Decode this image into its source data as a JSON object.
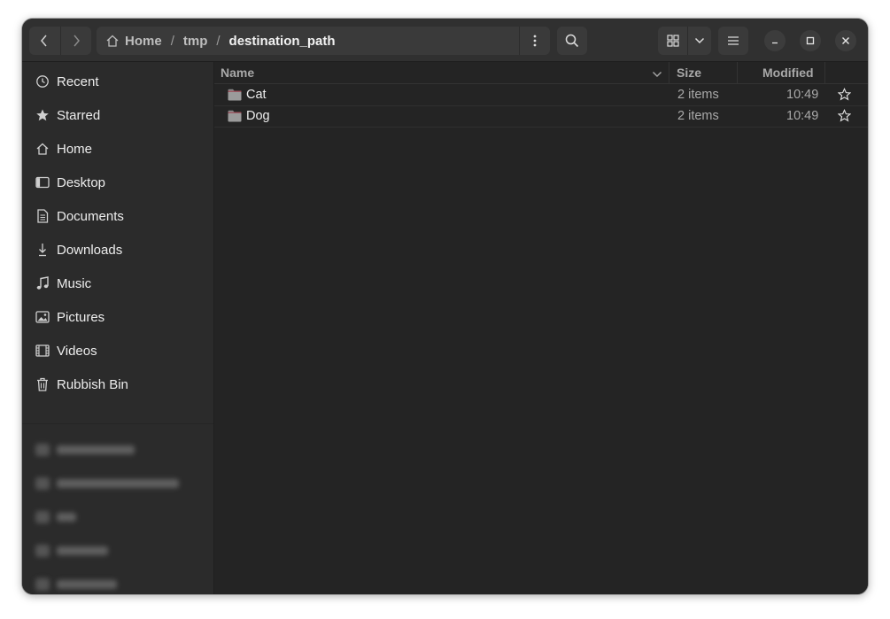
{
  "window": {
    "accent": "#e8e8e8"
  },
  "header": {
    "back_icon": "chevron-left-icon",
    "forward_icon": "chevron-right-icon",
    "breadcrumb": [
      {
        "label": "Home",
        "icon": "home-icon"
      },
      {
        "label": "tmp"
      },
      {
        "label": "destination_path"
      }
    ],
    "breadcrumb_separator": "/",
    "path_menu_icon": "kebab-menu-icon",
    "search_icon": "search-icon",
    "view_icon": "grid-view-icon",
    "view_options_icon": "chevron-down-icon",
    "main_menu_icon": "hamburger-menu-icon",
    "window_controls": [
      "minimize-icon",
      "maximize-icon",
      "close-icon"
    ]
  },
  "sidebar": {
    "items": [
      {
        "label": "Recent",
        "icon": "clock-icon"
      },
      {
        "label": "Starred",
        "icon": "star-icon"
      },
      {
        "label": "Home",
        "icon": "home-icon"
      },
      {
        "label": "Desktop",
        "icon": "desktop-icon"
      },
      {
        "label": "Documents",
        "icon": "document-icon"
      },
      {
        "label": "Downloads",
        "icon": "download-icon"
      },
      {
        "label": "Music",
        "icon": "music-icon"
      },
      {
        "label": "Pictures",
        "icon": "picture-icon"
      },
      {
        "label": "Videos",
        "icon": "video-icon"
      },
      {
        "label": "Rubbish Bin",
        "icon": "trash-icon"
      }
    ]
  },
  "columns": {
    "name": "Name",
    "size": "Size",
    "modified": "Modified"
  },
  "files": [
    {
      "name": "Cat",
      "size": "2 items",
      "modified": "10:49",
      "icon": "folder-icon"
    },
    {
      "name": "Dog",
      "size": "2 items",
      "modified": "10:49",
      "icon": "folder-icon"
    }
  ],
  "colors": {
    "folder": "#a04b57",
    "background": "#242424",
    "sidebar": "#2b2b2b",
    "header": "#303030"
  }
}
